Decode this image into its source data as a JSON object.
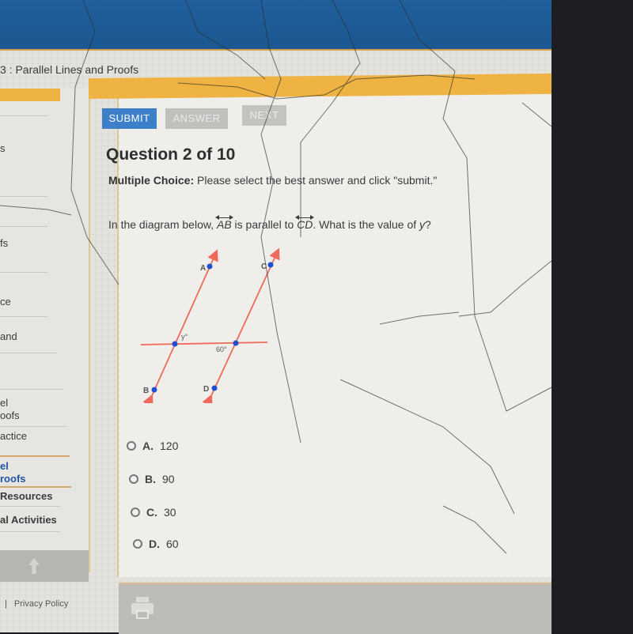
{
  "breadcrumb": {
    "text": "3 : Parallel Lines and Proofs"
  },
  "sidebar": {
    "items": [
      {
        "label": "s"
      },
      {
        "label": "fs"
      },
      {
        "label": "ce"
      },
      {
        "label": "and"
      },
      {
        "label": "el"
      },
      {
        "label": "oofs"
      },
      {
        "label": "actice"
      },
      {
        "label": "el"
      },
      {
        "label": "roofs"
      },
      {
        "label": "Resources"
      },
      {
        "label": "al Activities"
      }
    ],
    "active_item": "Parallel Proofs"
  },
  "toolbar": {
    "submit_label": "SUBMIT",
    "answer_label": "ANSWER",
    "next_label": "NEXT"
  },
  "question": {
    "title": "Question 2 of 10",
    "instruction_label": "Multiple Choice:",
    "instruction_text": " Please select the best answer and click \"submit.\"",
    "prompt_pre": "In the diagram below, ",
    "ray1": "AB",
    "prompt_mid": " is parallel to ",
    "ray2": "CD",
    "prompt_post": ". What is the value of ",
    "variable": "y",
    "prompt_end": "?"
  },
  "diagram": {
    "points": [
      "A",
      "B",
      "C",
      "D"
    ],
    "angle_labels": {
      "y": "y°",
      "given": "60°"
    },
    "line_color": "#f06a5c",
    "point_color": "#1f4fd1"
  },
  "choices": [
    {
      "letter": "A.",
      "value": "120"
    },
    {
      "letter": "B.",
      "value": "90"
    },
    {
      "letter": "C.",
      "value": "30"
    },
    {
      "letter": "D.",
      "value": "60"
    }
  ],
  "footer": {
    "privacy": "Privacy Policy",
    "separator": "|"
  },
  "icons": {
    "print": "printer-icon",
    "scroll_up": "arrow-up-icon"
  }
}
